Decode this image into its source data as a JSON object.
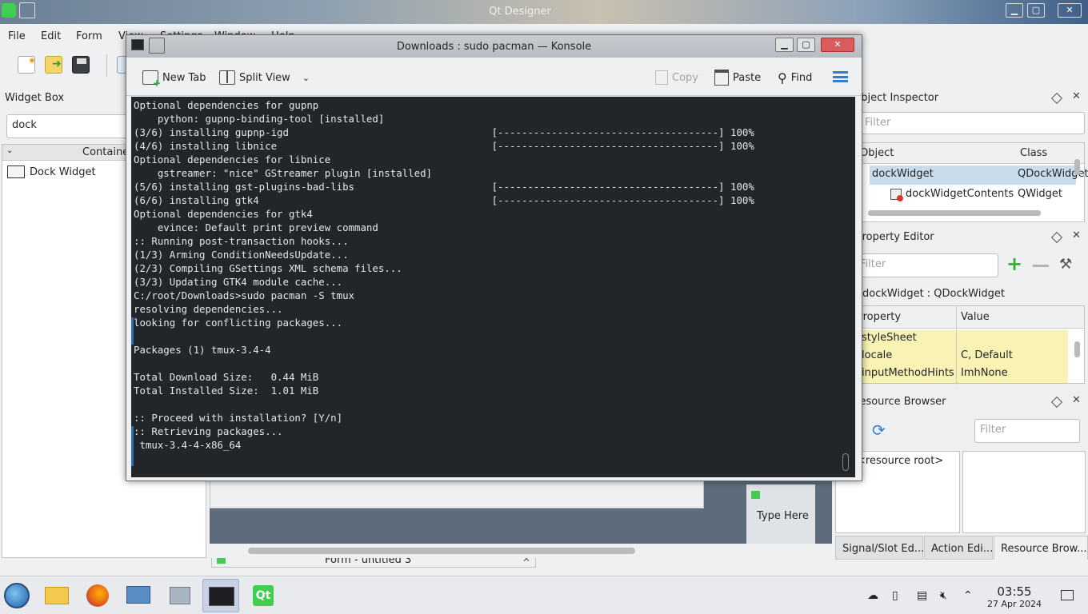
{
  "qt": {
    "window_title": "Qt Designer",
    "menu": [
      "File",
      "Edit",
      "Form",
      "View",
      "Settings",
      "Window",
      "Help"
    ],
    "widget_box": {
      "title": "Widget Box",
      "filter_value": "dock",
      "category": "Containers",
      "item": "Dock Widget"
    },
    "object_inspector": {
      "title": "Object Inspector",
      "filter_placeholder": "Filter",
      "col_object": "Object",
      "col_class": "Class",
      "rows": [
        {
          "object": "dockWidget",
          "class": "QDockWidget"
        },
        {
          "object": "dockWidgetContents",
          "class": "QWidget"
        }
      ]
    },
    "property_editor": {
      "title": "Property Editor",
      "filter_placeholder": "Filter",
      "object_label": "dockWidget : QDockWidget",
      "col_property": "Property",
      "col_value": "Value",
      "rows": [
        {
          "property": "styleSheet",
          "value": ""
        },
        {
          "property": "locale",
          "value": "C, Default"
        },
        {
          "property": "inputMethodHints",
          "value": "ImhNone"
        }
      ]
    },
    "resource_browser": {
      "title": "Resource Browser",
      "filter_placeholder": "Filter",
      "root": "<resource root>"
    },
    "bottom_tabs": [
      "Signal/Slot Ed...",
      "Action Edi...",
      "Resource Brow..."
    ],
    "form_tab_title": "Form - untitled 3",
    "type_here": "Type Here"
  },
  "konsole": {
    "title": "Downloads : sudo pacman — Konsole",
    "toolbar": {
      "new_tab": "New Tab",
      "split_view": "Split View",
      "copy": "Copy",
      "paste": "Paste",
      "find": "Find"
    },
    "output": "Optional dependencies for gupnp\n    python: gupnp-binding-tool [installed]\n(3/6) installing gupnp-igd                                  [-------------------------------------] 100%\n(4/6) installing libnice                                    [-------------------------------------] 100%\nOptional dependencies for libnice\n    gstreamer: \"nice\" GStreamer plugin [installed]\n(5/6) installing gst-plugins-bad-libs                       [-------------------------------------] 100%\n(6/6) installing gtk4                                       [-------------------------------------] 100%\nOptional dependencies for gtk4\n    evince: Default print preview command\n:: Running post-transaction hooks...\n(1/3) Arming ConditionNeedsUpdate...\n(2/3) Compiling GSettings XML schema files...\n(3/3) Updating GTK4 module cache...\nC:/root/Downloads>sudo pacman -S tmux\nresolving dependencies...\nlooking for conflicting packages...\n\nPackages (1) tmux-3.4-4\n\nTotal Download Size:   0.44 MiB\nTotal Installed Size:  1.01 MiB\n\n:: Proceed with installation? [Y/n]\n:: Retrieving packages...\n tmux-3.4-4-x86_64"
  },
  "taskbar": {
    "time": "03:55",
    "date": "27 Apr 2024"
  },
  "colors": {
    "terminal_bg": "#232629",
    "selection": "#c9dcec",
    "accent": "#3daee9",
    "highlight_row": "#f8f2b4"
  }
}
